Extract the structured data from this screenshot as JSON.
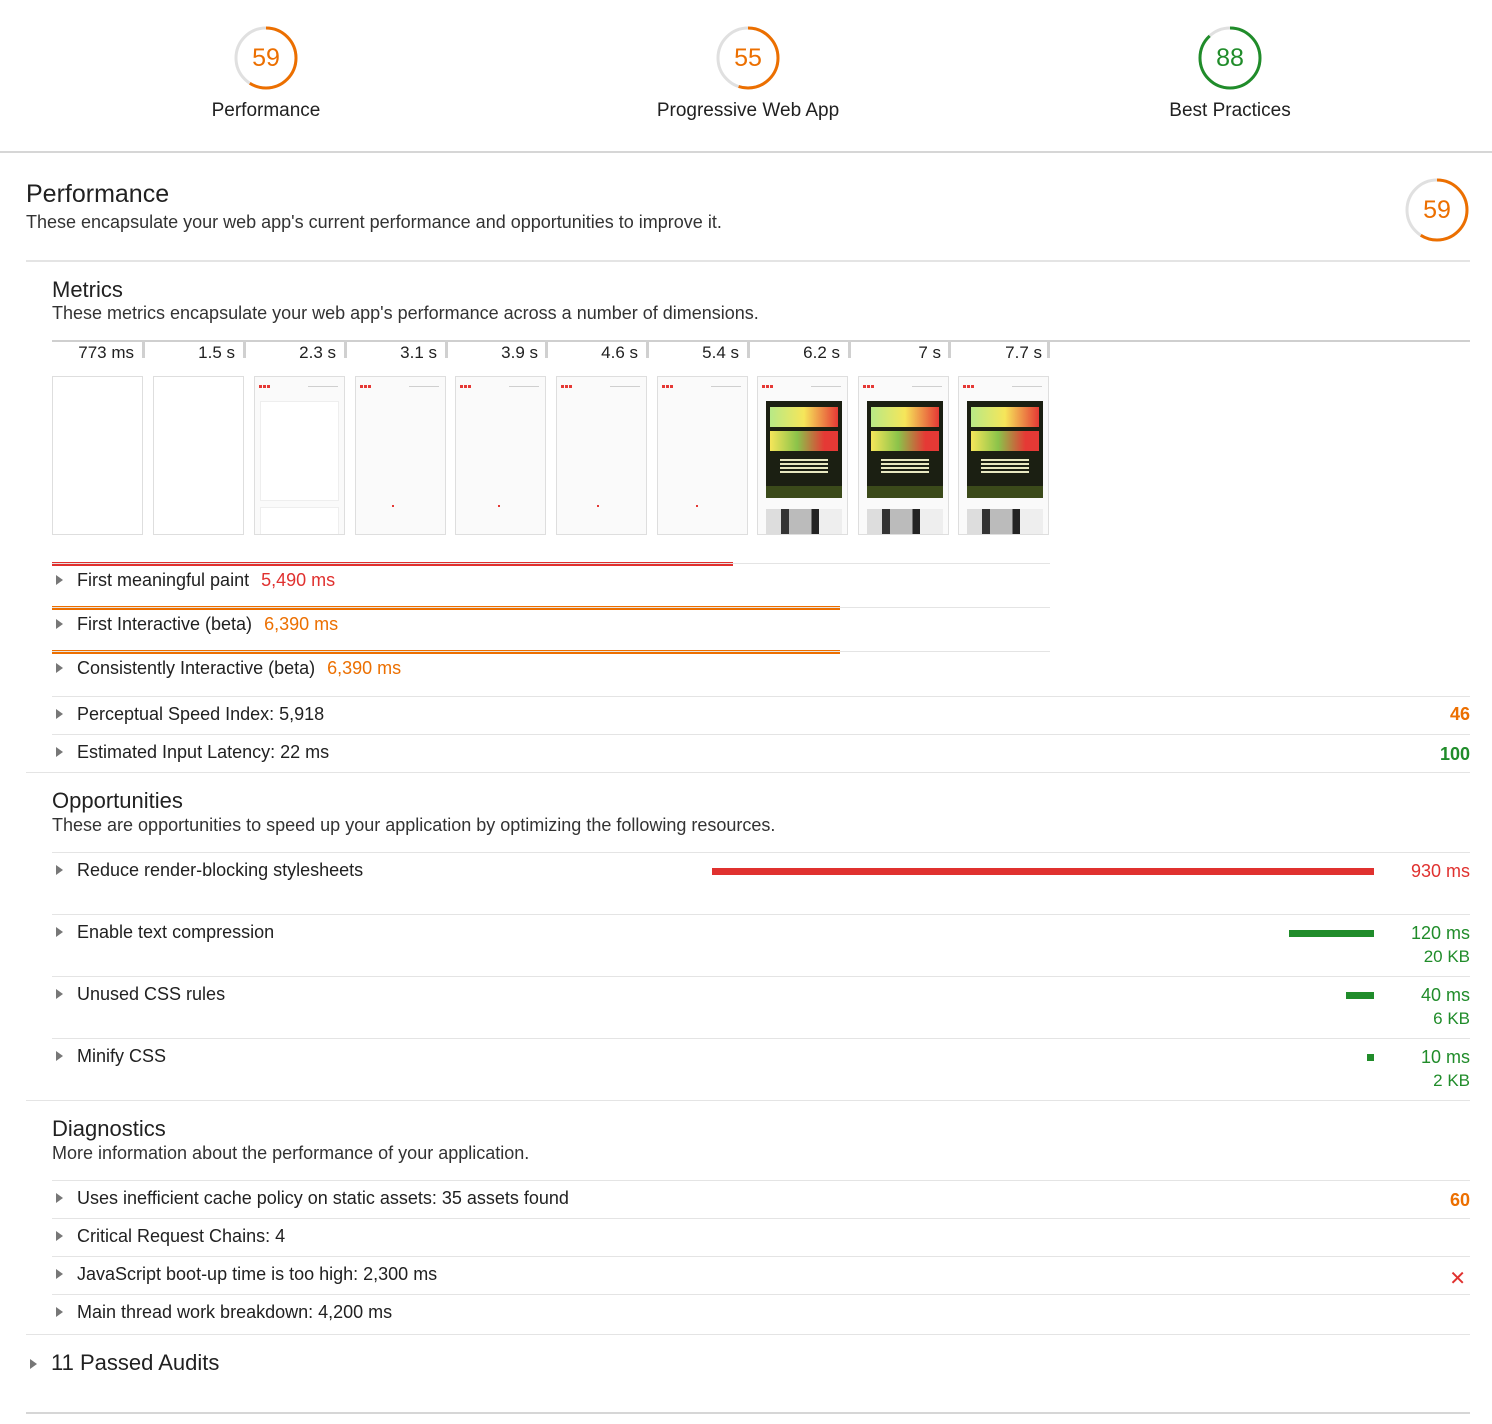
{
  "top_scores": [
    {
      "score": "59",
      "label": "Performance",
      "color": "#ec6f00",
      "fraction": 0.59
    },
    {
      "score": "55",
      "label": "Progressive Web App",
      "color": "#ec6f00",
      "fraction": 0.55
    },
    {
      "score": "88",
      "label": "Best Practices",
      "color": "#208c2a",
      "fraction": 0.88
    }
  ],
  "category": {
    "title": "Performance",
    "description": "These encapsulate your web app's current performance and opportunities to improve it.",
    "score": "59",
    "score_fraction": 0.59,
    "score_color": "#ec6f00"
  },
  "metrics": {
    "title": "Metrics",
    "description": "These metrics encapsulate your web app's performance across a number of dimensions.",
    "filmstrip_times": [
      "773 ms",
      "1.5 s",
      "2.3 s",
      "3.1 s",
      "3.9 s",
      "4.6 s",
      "5.4 s",
      "6.2 s",
      "7 s",
      "7.7 s"
    ],
    "timeline_rows": [
      {
        "label": "First meaningful paint",
        "value": "5,490 ms",
        "color": "#e0312f",
        "duration_ms": 5490
      },
      {
        "label": "First Interactive (beta)",
        "value": "6,390 ms",
        "color": "#ec6f00",
        "duration_ms": 6390
      },
      {
        "label": "Consistently Interactive (beta)",
        "value": "6,390 ms",
        "color": "#ec6f00",
        "duration_ms": 6390
      }
    ],
    "timeline_max_ms": 7700,
    "scored_rows": [
      {
        "label": "Perceptual Speed Index: 5,918",
        "score": "46",
        "color": "#ec6f00"
      },
      {
        "label": "Estimated Input Latency: 22 ms",
        "score": "100",
        "color": "#208c2a"
      }
    ]
  },
  "opportunities": {
    "title": "Opportunities",
    "description": "These are opportunities to speed up your application by optimizing the following resources.",
    "items": [
      {
        "label": "Reduce render-blocking stylesheets",
        "ms": "930 ms",
        "kb": "",
        "color": "#e0312f",
        "savings_ms": 930
      },
      {
        "label": "Enable text compression",
        "ms": "120 ms",
        "kb": "20 KB",
        "color": "#208c2a",
        "savings_ms": 120
      },
      {
        "label": "Unused CSS rules",
        "ms": "40 ms",
        "kb": "6 KB",
        "color": "#208c2a",
        "savings_ms": 40
      },
      {
        "label": "Minify CSS",
        "ms": "10 ms",
        "kb": "2 KB",
        "color": "#208c2a",
        "savings_ms": 10
      }
    ]
  },
  "diagnostics": {
    "title": "Diagnostics",
    "description": "More information about the performance of your application.",
    "items": [
      {
        "label": "Uses inefficient cache policy on static assets: 35 assets found",
        "score": "60",
        "color": "#ec6f00",
        "status": "score"
      },
      {
        "label": "Critical Request Chains: 4",
        "score": "",
        "status": "info"
      },
      {
        "label": "JavaScript boot-up time is too high: 2,300 ms",
        "score": "✕",
        "status": "fail"
      },
      {
        "label": "Main thread work breakdown: 4,200 ms",
        "score": "",
        "status": "info"
      }
    ]
  },
  "passed_audits_label": "11 Passed Audits"
}
